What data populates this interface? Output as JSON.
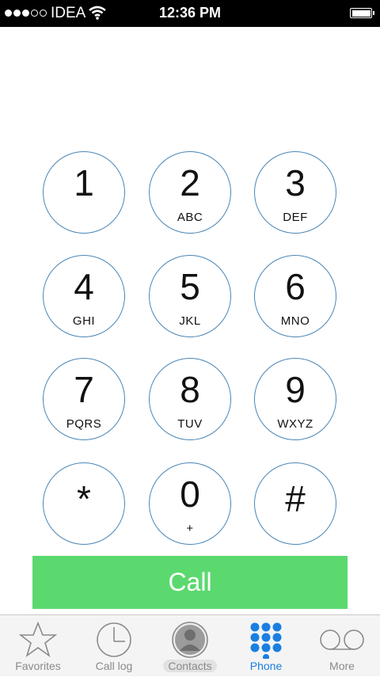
{
  "status_bar": {
    "carrier": "IDEA",
    "time": "12:36 PM",
    "signal_full": 3,
    "signal_empty": 2
  },
  "keypad": {
    "keys": [
      {
        "digit": "1",
        "letters": ""
      },
      {
        "digit": "2",
        "letters": "ABC"
      },
      {
        "digit": "3",
        "letters": "DEF"
      },
      {
        "digit": "4",
        "letters": "GHI"
      },
      {
        "digit": "5",
        "letters": "JKL"
      },
      {
        "digit": "6",
        "letters": "MNO"
      },
      {
        "digit": "7",
        "letters": "PQRS"
      },
      {
        "digit": "8",
        "letters": "TUV"
      },
      {
        "digit": "9",
        "letters": "WXYZ"
      },
      {
        "digit": "*",
        "letters": ""
      },
      {
        "digit": "0",
        "letters": "+"
      },
      {
        "digit": "#",
        "letters": ""
      }
    ]
  },
  "call_button": {
    "label": "Call",
    "color": "#5bd96f"
  },
  "tab_bar": {
    "active_color": "#1a7fe0",
    "tabs": [
      {
        "label": "Favorites",
        "icon": "star-icon"
      },
      {
        "label": "Call log",
        "icon": "clock-icon"
      },
      {
        "label": "Contacts",
        "icon": "contact-avatar-icon"
      },
      {
        "label": "Phone",
        "icon": "keypad-grid-icon",
        "active": true
      },
      {
        "label": "More",
        "icon": "voicemail-icon"
      }
    ]
  }
}
